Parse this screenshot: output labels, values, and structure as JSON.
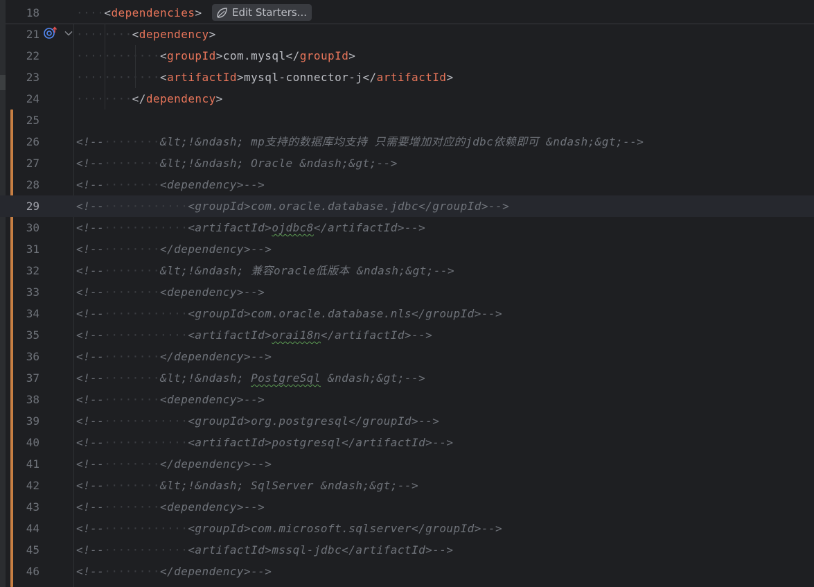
{
  "editor": {
    "sticky_line": {
      "number": "18",
      "indent": "····",
      "open": "<",
      "tag": "dependencies",
      "close": ">"
    },
    "starters_chip": {
      "icon": "spring-leaf-icon",
      "label": "Edit Starters..."
    },
    "gutter_icons": [
      "implemented-override-icon",
      "fold-chevron-icon"
    ],
    "colors": {
      "background": "#1e1f22",
      "tag": "#e8755a",
      "text": "#bcbec4",
      "comment": "#6f737a",
      "change_marker": "#c77f43",
      "current_line": "#26282e"
    },
    "current_line": "29",
    "lines": [
      {
        "n": "21",
        "segs": [
          {
            "t": "ws",
            "v": "········"
          },
          {
            "t": "br",
            "v": "<"
          },
          {
            "t": "tag",
            "v": "dependency"
          },
          {
            "t": "br",
            "v": ">"
          }
        ]
      },
      {
        "n": "22",
        "segs": [
          {
            "t": "ws",
            "v": "············"
          },
          {
            "t": "br",
            "v": "<"
          },
          {
            "t": "tag",
            "v": "groupId"
          },
          {
            "t": "br",
            "v": ">"
          },
          {
            "t": "txt",
            "v": "com.mysql"
          },
          {
            "t": "br",
            "v": "</"
          },
          {
            "t": "tag",
            "v": "groupId"
          },
          {
            "t": "br",
            "v": ">"
          }
        ]
      },
      {
        "n": "23",
        "segs": [
          {
            "t": "ws",
            "v": "············"
          },
          {
            "t": "br",
            "v": "<"
          },
          {
            "t": "tag",
            "v": "artifactId"
          },
          {
            "t": "br",
            "v": ">"
          },
          {
            "t": "txt",
            "v": "mysql-connector-j"
          },
          {
            "t": "br",
            "v": "</"
          },
          {
            "t": "tag",
            "v": "artifactId"
          },
          {
            "t": "br",
            "v": ">"
          }
        ]
      },
      {
        "n": "24",
        "segs": [
          {
            "t": "ws",
            "v": "········"
          },
          {
            "t": "br",
            "v": "</"
          },
          {
            "t": "tag",
            "v": "dependency"
          },
          {
            "t": "br",
            "v": ">"
          }
        ]
      },
      {
        "n": "25",
        "segs": []
      },
      {
        "n": "26",
        "segs": [
          {
            "t": "cm",
            "v": "<!--"
          },
          {
            "t": "ws",
            "v": "········"
          },
          {
            "t": "cm",
            "v": "&lt;!&ndash; mp支持的数据库均支持 只需要增加对应的jdbc依赖即可 &ndash;&gt;-->"
          }
        ]
      },
      {
        "n": "27",
        "segs": [
          {
            "t": "cm",
            "v": "<!--"
          },
          {
            "t": "ws",
            "v": "········"
          },
          {
            "t": "cm",
            "v": "&lt;!&ndash; Oracle &ndash;&gt;-->"
          }
        ]
      },
      {
        "n": "28",
        "segs": [
          {
            "t": "cm",
            "v": "<!--"
          },
          {
            "t": "ws",
            "v": "········"
          },
          {
            "t": "cm",
            "v": "<dependency>-->"
          }
        ]
      },
      {
        "n": "29",
        "segs": [
          {
            "t": "cm",
            "v": "<!--"
          },
          {
            "t": "ws",
            "v": "············"
          },
          {
            "t": "cm",
            "v": "<groupId>com.oracle.database.jdbc</groupId>-->"
          }
        ]
      },
      {
        "n": "30",
        "segs": [
          {
            "t": "cm",
            "v": "<!--"
          },
          {
            "t": "ws",
            "v": "············"
          },
          {
            "t": "cm",
            "v": "<artifactId>"
          },
          {
            "t": "cmsq",
            "v": "ojdbc8"
          },
          {
            "t": "cm",
            "v": "</artifactId>-->"
          }
        ]
      },
      {
        "n": "31",
        "segs": [
          {
            "t": "cm",
            "v": "<!--"
          },
          {
            "t": "ws",
            "v": "········"
          },
          {
            "t": "cm",
            "v": "</dependency>-->"
          }
        ]
      },
      {
        "n": "32",
        "segs": [
          {
            "t": "cm",
            "v": "<!--"
          },
          {
            "t": "ws",
            "v": "········"
          },
          {
            "t": "cm",
            "v": "&lt;!&ndash; 兼容oracle低版本 &ndash;&gt;-->"
          }
        ]
      },
      {
        "n": "33",
        "segs": [
          {
            "t": "cm",
            "v": "<!--"
          },
          {
            "t": "ws",
            "v": "········"
          },
          {
            "t": "cm",
            "v": "<dependency>-->"
          }
        ]
      },
      {
        "n": "34",
        "segs": [
          {
            "t": "cm",
            "v": "<!--"
          },
          {
            "t": "ws",
            "v": "············"
          },
          {
            "t": "cm",
            "v": "<groupId>com.oracle.database.nls</groupId>-->"
          }
        ]
      },
      {
        "n": "35",
        "segs": [
          {
            "t": "cm",
            "v": "<!--"
          },
          {
            "t": "ws",
            "v": "············"
          },
          {
            "t": "cm",
            "v": "<artifactId>"
          },
          {
            "t": "cmsq",
            "v": "orai18n"
          },
          {
            "t": "cm",
            "v": "</artifactId>-->"
          }
        ]
      },
      {
        "n": "36",
        "segs": [
          {
            "t": "cm",
            "v": "<!--"
          },
          {
            "t": "ws",
            "v": "········"
          },
          {
            "t": "cm",
            "v": "</dependency>-->"
          }
        ]
      },
      {
        "n": "37",
        "segs": [
          {
            "t": "cm",
            "v": "<!--"
          },
          {
            "t": "ws",
            "v": "········"
          },
          {
            "t": "cm",
            "v": "&lt;!&ndash; "
          },
          {
            "t": "cmsq",
            "v": "PostgreSql"
          },
          {
            "t": "cm",
            "v": " &ndash;&gt;-->"
          }
        ]
      },
      {
        "n": "38",
        "segs": [
          {
            "t": "cm",
            "v": "<!--"
          },
          {
            "t": "ws",
            "v": "········"
          },
          {
            "t": "cm",
            "v": "<dependency>-->"
          }
        ]
      },
      {
        "n": "39",
        "segs": [
          {
            "t": "cm",
            "v": "<!--"
          },
          {
            "t": "ws",
            "v": "············"
          },
          {
            "t": "cm",
            "v": "<groupId>org.postgresql</groupId>-->"
          }
        ]
      },
      {
        "n": "40",
        "segs": [
          {
            "t": "cm",
            "v": "<!--"
          },
          {
            "t": "ws",
            "v": "············"
          },
          {
            "t": "cm",
            "v": "<artifactId>postgresql</artifactId>-->"
          }
        ]
      },
      {
        "n": "41",
        "segs": [
          {
            "t": "cm",
            "v": "<!--"
          },
          {
            "t": "ws",
            "v": "········"
          },
          {
            "t": "cm",
            "v": "</dependency>-->"
          }
        ]
      },
      {
        "n": "42",
        "segs": [
          {
            "t": "cm",
            "v": "<!--"
          },
          {
            "t": "ws",
            "v": "········"
          },
          {
            "t": "cm",
            "v": "&lt;!&ndash; SqlServer &ndash;&gt;-->"
          }
        ]
      },
      {
        "n": "43",
        "segs": [
          {
            "t": "cm",
            "v": "<!--"
          },
          {
            "t": "ws",
            "v": "········"
          },
          {
            "t": "cm",
            "v": "<dependency>-->"
          }
        ]
      },
      {
        "n": "44",
        "segs": [
          {
            "t": "cm",
            "v": "<!--"
          },
          {
            "t": "ws",
            "v": "············"
          },
          {
            "t": "cm",
            "v": "<groupId>com.microsoft.sqlserver</groupId>-->"
          }
        ]
      },
      {
        "n": "45",
        "segs": [
          {
            "t": "cm",
            "v": "<!--"
          },
          {
            "t": "ws",
            "v": "············"
          },
          {
            "t": "cm",
            "v": "<artifactId>mssql-jdbc</artifactId>-->"
          }
        ]
      },
      {
        "n": "46",
        "segs": [
          {
            "t": "cm",
            "v": "<!--"
          },
          {
            "t": "ws",
            "v": "········"
          },
          {
            "t": "cm",
            "v": "</dependency>-->"
          }
        ]
      }
    ]
  }
}
